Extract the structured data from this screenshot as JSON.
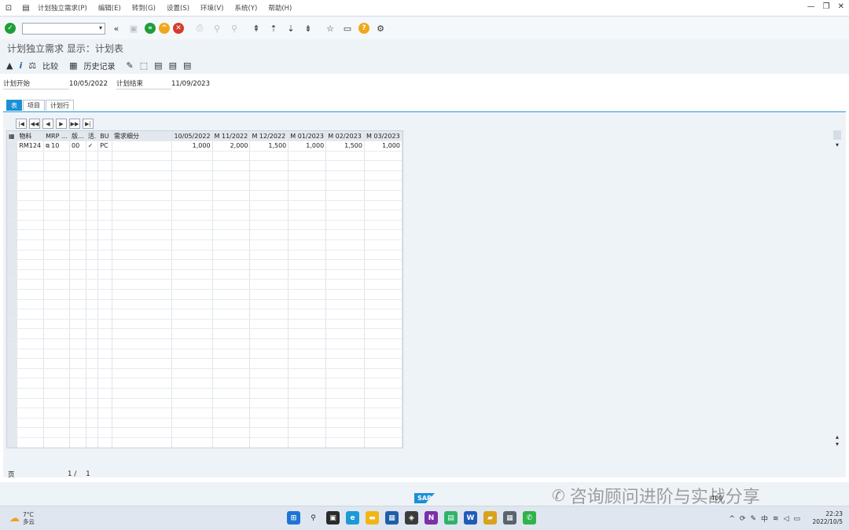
{
  "menu": {
    "items": [
      "计划独立需求(P)",
      "编辑(E)",
      "转到(G)",
      "设置(S)",
      "环境(V)",
      "系统(Y)",
      "帮助(H)"
    ]
  },
  "command_field": {
    "value": ""
  },
  "title": "计划独立需求 显示：计划表",
  "app_toolbar": {
    "compare_label": "比较",
    "history_label": "历史记录"
  },
  "fields": {
    "plan_start_label": "计划开始",
    "plan_start_value": "10/05/2022",
    "plan_end_label": "计划结束",
    "plan_end_value": "11/09/2023"
  },
  "tabs": [
    {
      "label": "表",
      "active": true
    },
    {
      "label": "项目",
      "active": false
    },
    {
      "label": "计划行",
      "active": false
    }
  ],
  "grid": {
    "headers": [
      "物料",
      "MRP ...",
      "版...",
      "活.",
      "BU",
      "需求细分",
      "10/05/2022",
      "M 11/2022",
      "M 12/2022",
      "M 01/2023",
      "M 02/2023",
      "M 03/2023"
    ],
    "rows": [
      [
        "RM124",
        "10",
        "00",
        "✓",
        "PC",
        "",
        "1,000",
        "2,000",
        "1,500",
        "1,000",
        "1,500",
        "1,000"
      ]
    ]
  },
  "pager": {
    "label": "页",
    "current": "1",
    "separator": "/",
    "total": "1"
  },
  "status": {
    "sys_info": "400",
    "watermark": "咨询顾问进阶与实战分享"
  },
  "taskbar": {
    "temperature": "7°C",
    "weather": "多云",
    "ime": "中",
    "time": "22:23",
    "date": "2022/10/5"
  },
  "colors": {
    "accent": "#1b8fd6",
    "ok": "#1e9e3a",
    "back": "#1e9e3a",
    "exit": "#f0a81b",
    "cancel": "#d63b2f",
    "help": "#f0a81b"
  }
}
